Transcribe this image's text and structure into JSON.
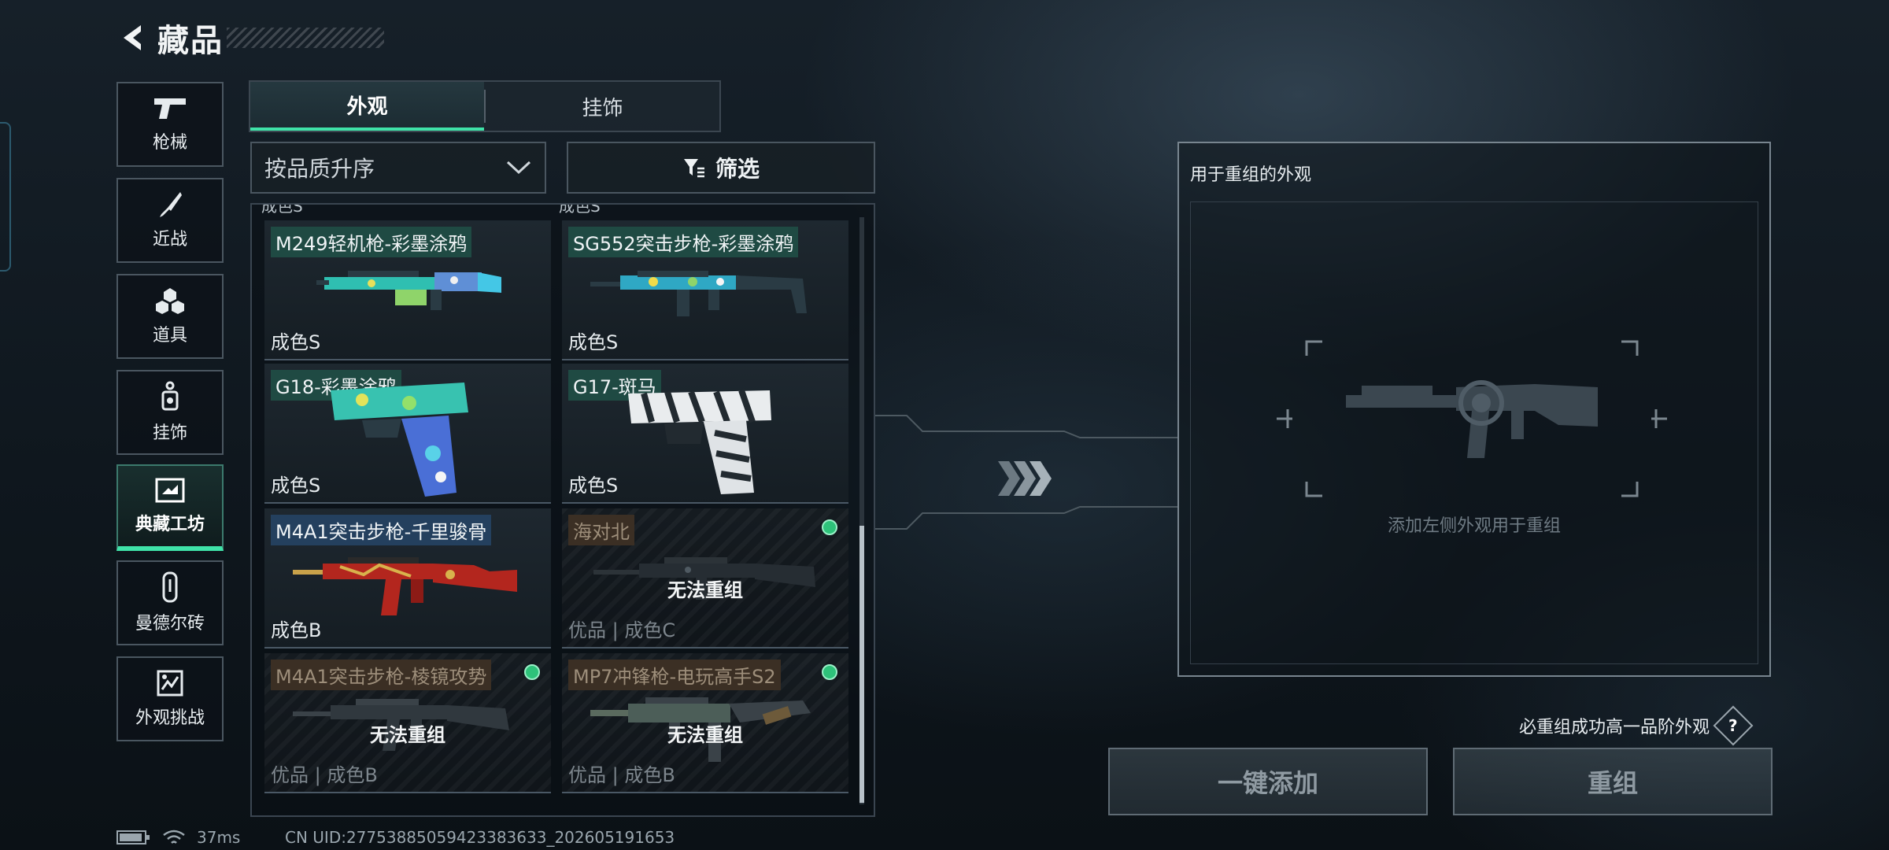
{
  "header": {
    "title": "藏品"
  },
  "sidebar": {
    "items": [
      {
        "label": "枪械",
        "icon": "pistol-icon"
      },
      {
        "label": "近战",
        "icon": "knife-icon"
      },
      {
        "label": "道具",
        "icon": "grenades-icon"
      },
      {
        "label": "挂饰",
        "icon": "charm-icon"
      },
      {
        "label": "典藏工坊",
        "icon": "workshop-icon",
        "active": true
      },
      {
        "label": "曼德尔砖",
        "icon": "brick-icon"
      },
      {
        "label": "外观挑战",
        "icon": "challenge-icon"
      }
    ]
  },
  "tabs": [
    {
      "label": "外观",
      "active": true
    },
    {
      "label": "挂饰",
      "active": false
    }
  ],
  "sort": {
    "value": "按品质升序"
  },
  "filter": {
    "label": "筛选"
  },
  "grid": {
    "cut_top": [
      "成色S",
      "成色S"
    ],
    "cards": [
      {
        "name": "M249轻机枪-彩墨涂鸦",
        "grade": "成色S",
        "disabled": false
      },
      {
        "name": "SG552突击步枪-彩墨涂鸦",
        "grade": "成色S",
        "disabled": false
      },
      {
        "name": "G18-彩墨涂鸦",
        "grade": "成色S",
        "disabled": false
      },
      {
        "name": "G17-斑马",
        "grade": "成色S",
        "disabled": false
      },
      {
        "name": "M4A1突击步枪-千里骏骨",
        "grade": "成色B",
        "disabled": false
      },
      {
        "name": "海对北",
        "grade": "优品 | 成色C",
        "disabled": true,
        "blocked": "无法重组"
      },
      {
        "name": "M4A1突击步枪-棱镜攻势",
        "grade": "优品 | 成色B",
        "disabled": true,
        "blocked": "无法重组"
      },
      {
        "name": "MP7冲锋枪-电玩高手S2",
        "grade": "优品 | 成色B",
        "disabled": true,
        "blocked": "无法重组"
      }
    ]
  },
  "recombine": {
    "panel_title": "用于重组的外观",
    "hint": "添加左侧外观用于重组",
    "note": "必重组成功高一品阶外观",
    "help_symbol": "?",
    "add_button": "一键添加",
    "recombine_button": "重组"
  },
  "status": {
    "ping": "37ms",
    "uid": "CN UID:2775388505942338363​3_202605191653"
  },
  "colors": {
    "accent": "#3fe3a8",
    "tag_green": "#1f4a43",
    "tag_blue": "#24405e",
    "dot": "#2ec27a"
  }
}
